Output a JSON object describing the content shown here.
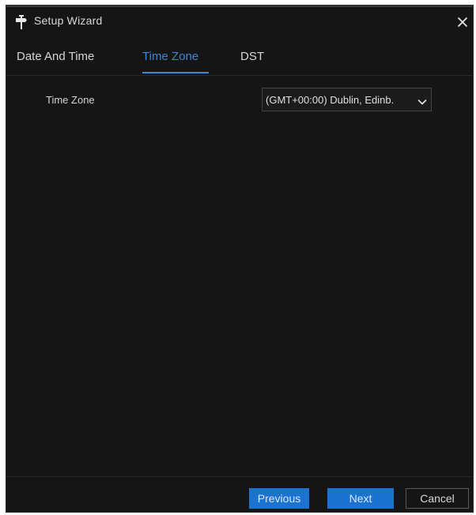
{
  "window": {
    "title": "Setup Wizard",
    "title_icon": "signpost-icon",
    "close_icon": "close-icon"
  },
  "tabs": [
    {
      "label": "Date And Time",
      "active": false
    },
    {
      "label": "Time Zone",
      "active": true
    },
    {
      "label": "DST",
      "active": false
    }
  ],
  "form": {
    "time_zone_label": "Time Zone",
    "time_zone_value": "(GMT+00:00) Dublin, Edinb.",
    "dropdown_icon": "chevron-down-icon"
  },
  "footer": {
    "previous_label": "Previous",
    "next_label": "Next",
    "cancel_label": "Cancel"
  },
  "colors": {
    "background": "#151515",
    "accent": "#3f86d6",
    "primary_button": "#1b73d0",
    "text": "#d6d6d6"
  }
}
